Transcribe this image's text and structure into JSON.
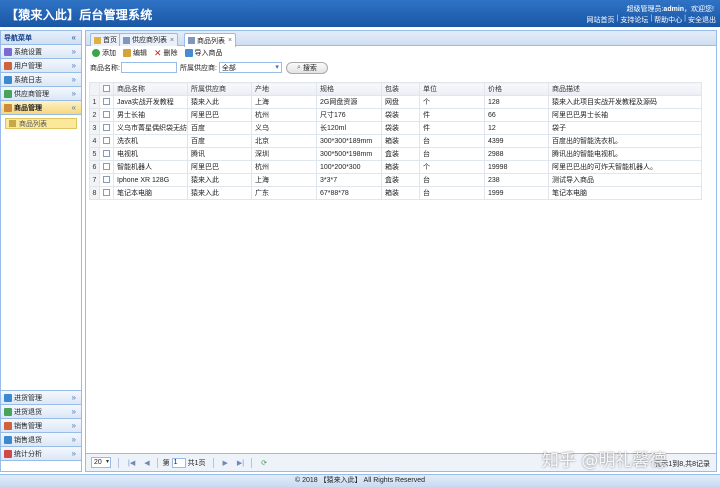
{
  "header": {
    "title": "【猿来入此】后台管理系统",
    "welcome_prefix": "超级管理员:",
    "welcome_user": "admin",
    "welcome_suffix": "，欢迎您!",
    "links": [
      "网站首页",
      "支持论坛",
      "帮助中心",
      "安全退出"
    ]
  },
  "sidebar": {
    "title": "导航菜单",
    "top_items": [
      {
        "label": "系统设置",
        "icon": "wrench-icon",
        "color": "#7a6bd0"
      },
      {
        "label": "用户管理",
        "icon": "users-icon",
        "color": "#d0623b"
      },
      {
        "label": "系统日志",
        "icon": "log-icon",
        "color": "#3b8ad0"
      },
      {
        "label": "供应商管理",
        "icon": "supplier-icon",
        "color": "#4aa35a"
      },
      {
        "label": "商品管理",
        "icon": "goods-icon",
        "color": "#d08a3b"
      }
    ],
    "active_sub_item": "商品列表",
    "bottom_items": [
      {
        "label": "进货管理",
        "icon": "purchase-icon",
        "color": "#3b8ad0"
      },
      {
        "label": "进货退货",
        "icon": "return-icon",
        "color": "#4aa35a"
      },
      {
        "label": "销售管理",
        "icon": "sales-icon",
        "color": "#d0623b"
      },
      {
        "label": "销售退货",
        "icon": "sales-return-icon",
        "color": "#3b8ad0"
      },
      {
        "label": "统计分析",
        "icon": "stats-icon",
        "color": "#d04a4a"
      }
    ]
  },
  "tabs": [
    {
      "label": "首页",
      "closable": false
    },
    {
      "label": "供应商列表",
      "closable": true
    },
    {
      "label": "商品列表",
      "closable": true,
      "active": true
    }
  ],
  "toolbar": {
    "add": "添加",
    "edit": "编辑",
    "delete": "删除",
    "import": "导入商品"
  },
  "search": {
    "name_label": "商品名称:",
    "name_value": "",
    "supplier_label": "所属供应商:",
    "supplier_value": "全部",
    "button": "搜索"
  },
  "table": {
    "columns": [
      "商品名称",
      "所属供应商",
      "产地",
      "规格",
      "包装",
      "单位",
      "价格",
      "商品描述"
    ],
    "rows": [
      [
        "Java实战开发教程",
        "猿来入此",
        "上海",
        "2G网盘资源",
        "网盘",
        "个",
        "128",
        "猿来入此项目实战开发教程及源码"
      ],
      [
        "男士长袖",
        "阿里巴巴",
        "杭州",
        "尺寸176",
        "袋装",
        "件",
        "66",
        "阿里巴巴男士长袖"
      ],
      [
        "义乌市菁星偶织袋无纺",
        "百度",
        "义乌",
        "长120ml",
        "袋装",
        "件",
        "12",
        "袋子"
      ],
      [
        "洗衣机",
        "百度",
        "北京",
        "300*300*189mm",
        "箱装",
        "台",
        "4399",
        "百度出的智能洗衣机。"
      ],
      [
        "电视机",
        "腾讯",
        "深圳",
        "300*500*198mm",
        "盒装",
        "台",
        "2988",
        "腾讯出的智能电视机。"
      ],
      [
        "智能机器人",
        "阿里巴巴",
        "杭州",
        "100*200*300",
        "箱装",
        "个",
        "19998",
        "阿里巴巴出的可炸天智能机器人。"
      ],
      [
        "Iphone XR 128G",
        "猿来入此",
        "上海",
        "3*3*7",
        "盒装",
        "台",
        "238",
        "测试导入商品"
      ],
      [
        "笔记本电脑",
        "猿来入此",
        "广东",
        "67*88*78",
        "箱装",
        "台",
        "1999",
        "笔记本电脑"
      ]
    ]
  },
  "pager": {
    "page_size": "20",
    "page_prefix": "第",
    "page_value": "1",
    "page_suffix": "共1页",
    "info": "显示1到8,共8记录"
  },
  "footer": "© 2018 【猿来入此】 All Rights Reserved",
  "watermark": "知乎 @明礼馨德"
}
